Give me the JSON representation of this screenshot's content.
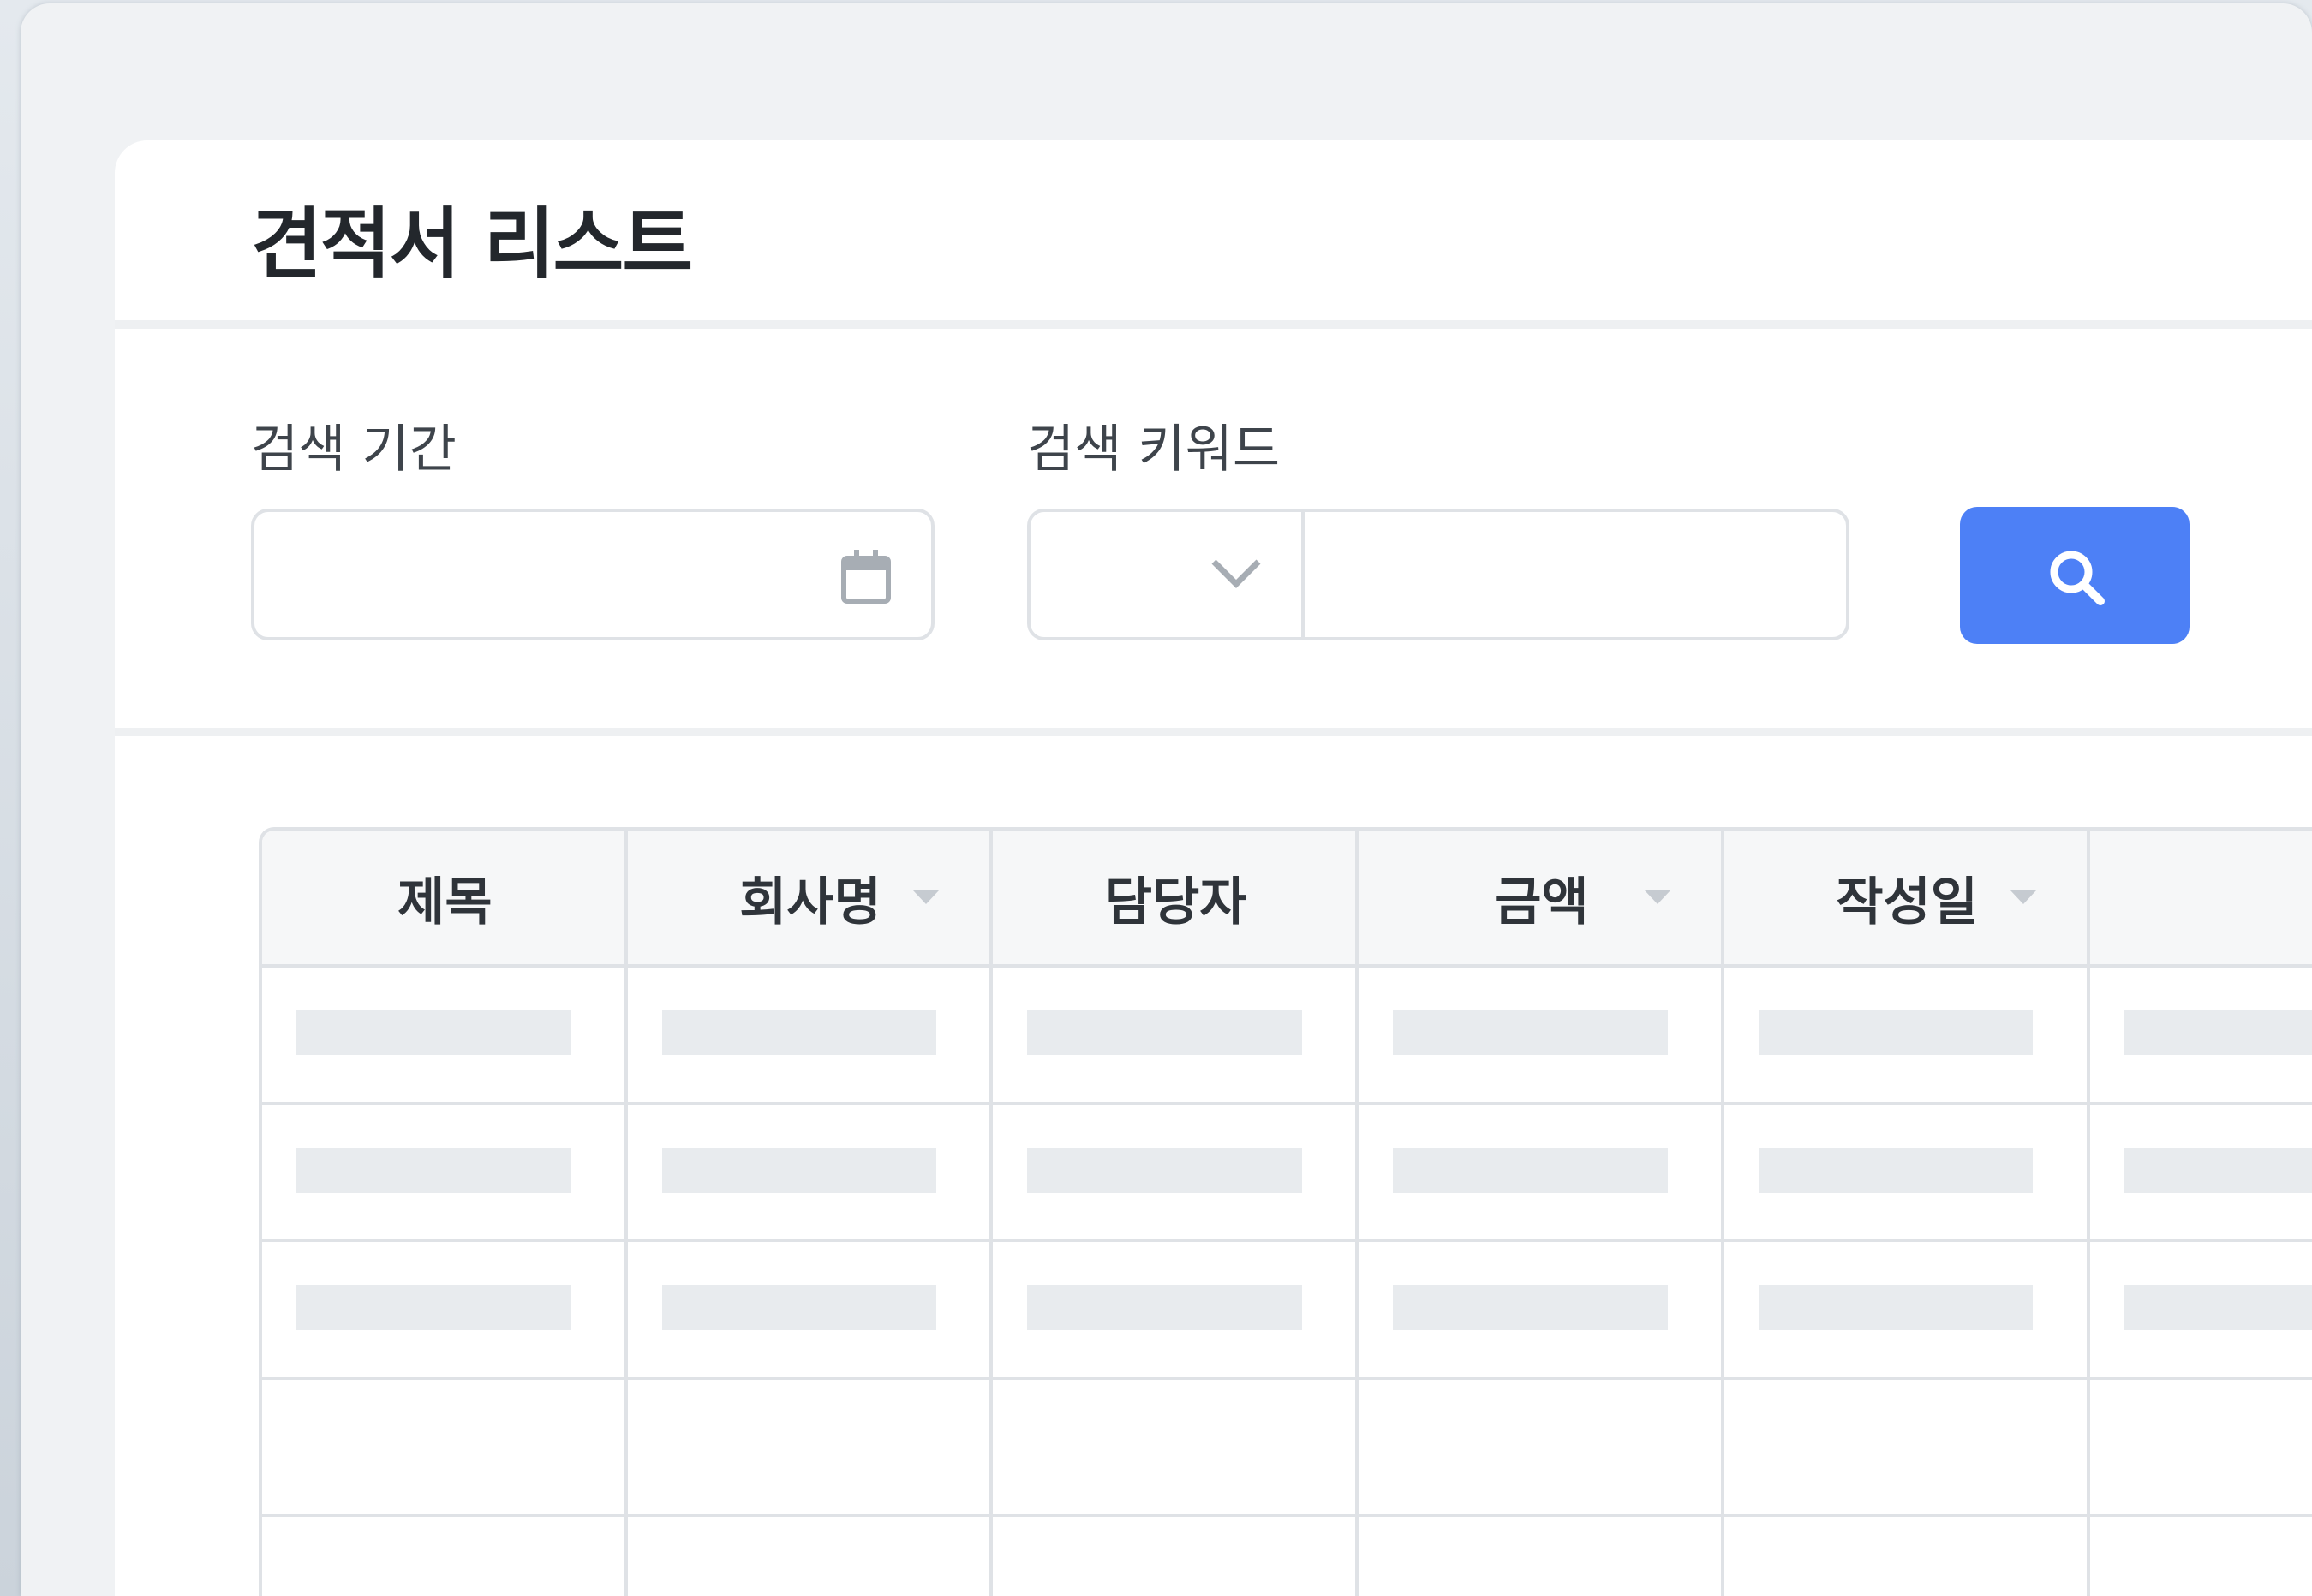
{
  "page": {
    "title": "견적서 리스트"
  },
  "search": {
    "period_label": "검색 기간",
    "period_value": "",
    "keyword_label": "검색 키워드",
    "keyword_type_value": "",
    "keyword_value": "",
    "search_icon": "search-icon"
  },
  "table": {
    "columns": [
      {
        "label": "제목",
        "sortable": false
      },
      {
        "label": "회사명",
        "sortable": true
      },
      {
        "label": "담당자",
        "sortable": false
      },
      {
        "label": "금액",
        "sortable": true
      },
      {
        "label": "작성일",
        "sortable": true
      },
      {
        "label": "",
        "sortable": false
      }
    ],
    "loading_rows": 3,
    "empty_rows": 2
  },
  "colors": {
    "accent": "#4d80f6",
    "skeleton": "#e8ebee",
    "border": "#dfe2e6"
  }
}
